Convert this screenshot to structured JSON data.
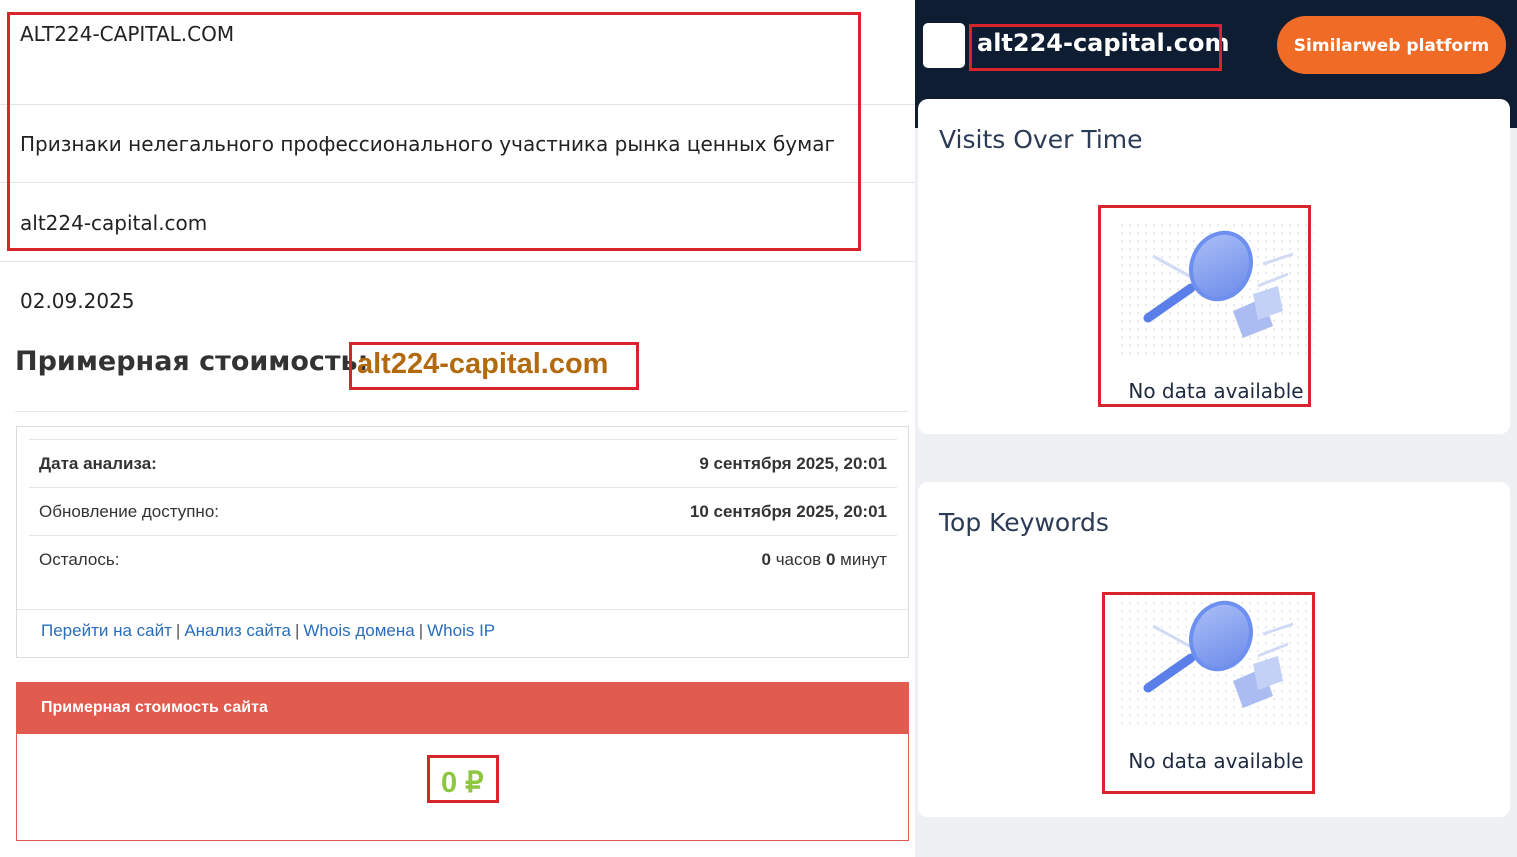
{
  "registry": {
    "name": "ALT224-CAPITAL.COM",
    "description": "Признаки нелегального профессионального участника рынка ценных бумаг",
    "site": "alt224-capital.com"
  },
  "date": "02.09.2025",
  "estimate": {
    "heading": "Примерная стоимость:",
    "domain": "alt224-capital.com"
  },
  "info": {
    "rows": [
      {
        "label": "Дата анализа:",
        "value": "9 сентября 2025, 20:01"
      },
      {
        "label": "Обновление доступно:",
        "value": "10 сентября 2025, 20:01"
      },
      {
        "label": "Осталось:",
        "hours_num": "0",
        "hours_unit": "часов",
        "minutes_num": "0",
        "minutes_unit": "минут"
      }
    ],
    "links": [
      "Перейти на сайт",
      "Анализ сайта",
      "Whois домена",
      "Whois IP"
    ],
    "separator": "|"
  },
  "price": {
    "header": "Примерная стоимость сайта",
    "value": "0 ₽"
  },
  "similarweb": {
    "site_title": "alt224-capital.com",
    "platform_button": "Similarweb platform",
    "cards": [
      {
        "title": "Visits Over Time",
        "empty_text": "No data available"
      },
      {
        "title": "Top Keywords",
        "empty_text": "No data available"
      }
    ]
  },
  "colors": {
    "highlight": "#d9232d",
    "brand_orange": "#f06b26",
    "navy": "#0f1d33",
    "price_red": "#e15b4f",
    "price_green": "#8dc63f",
    "domain_gold": "#b36a0e"
  }
}
